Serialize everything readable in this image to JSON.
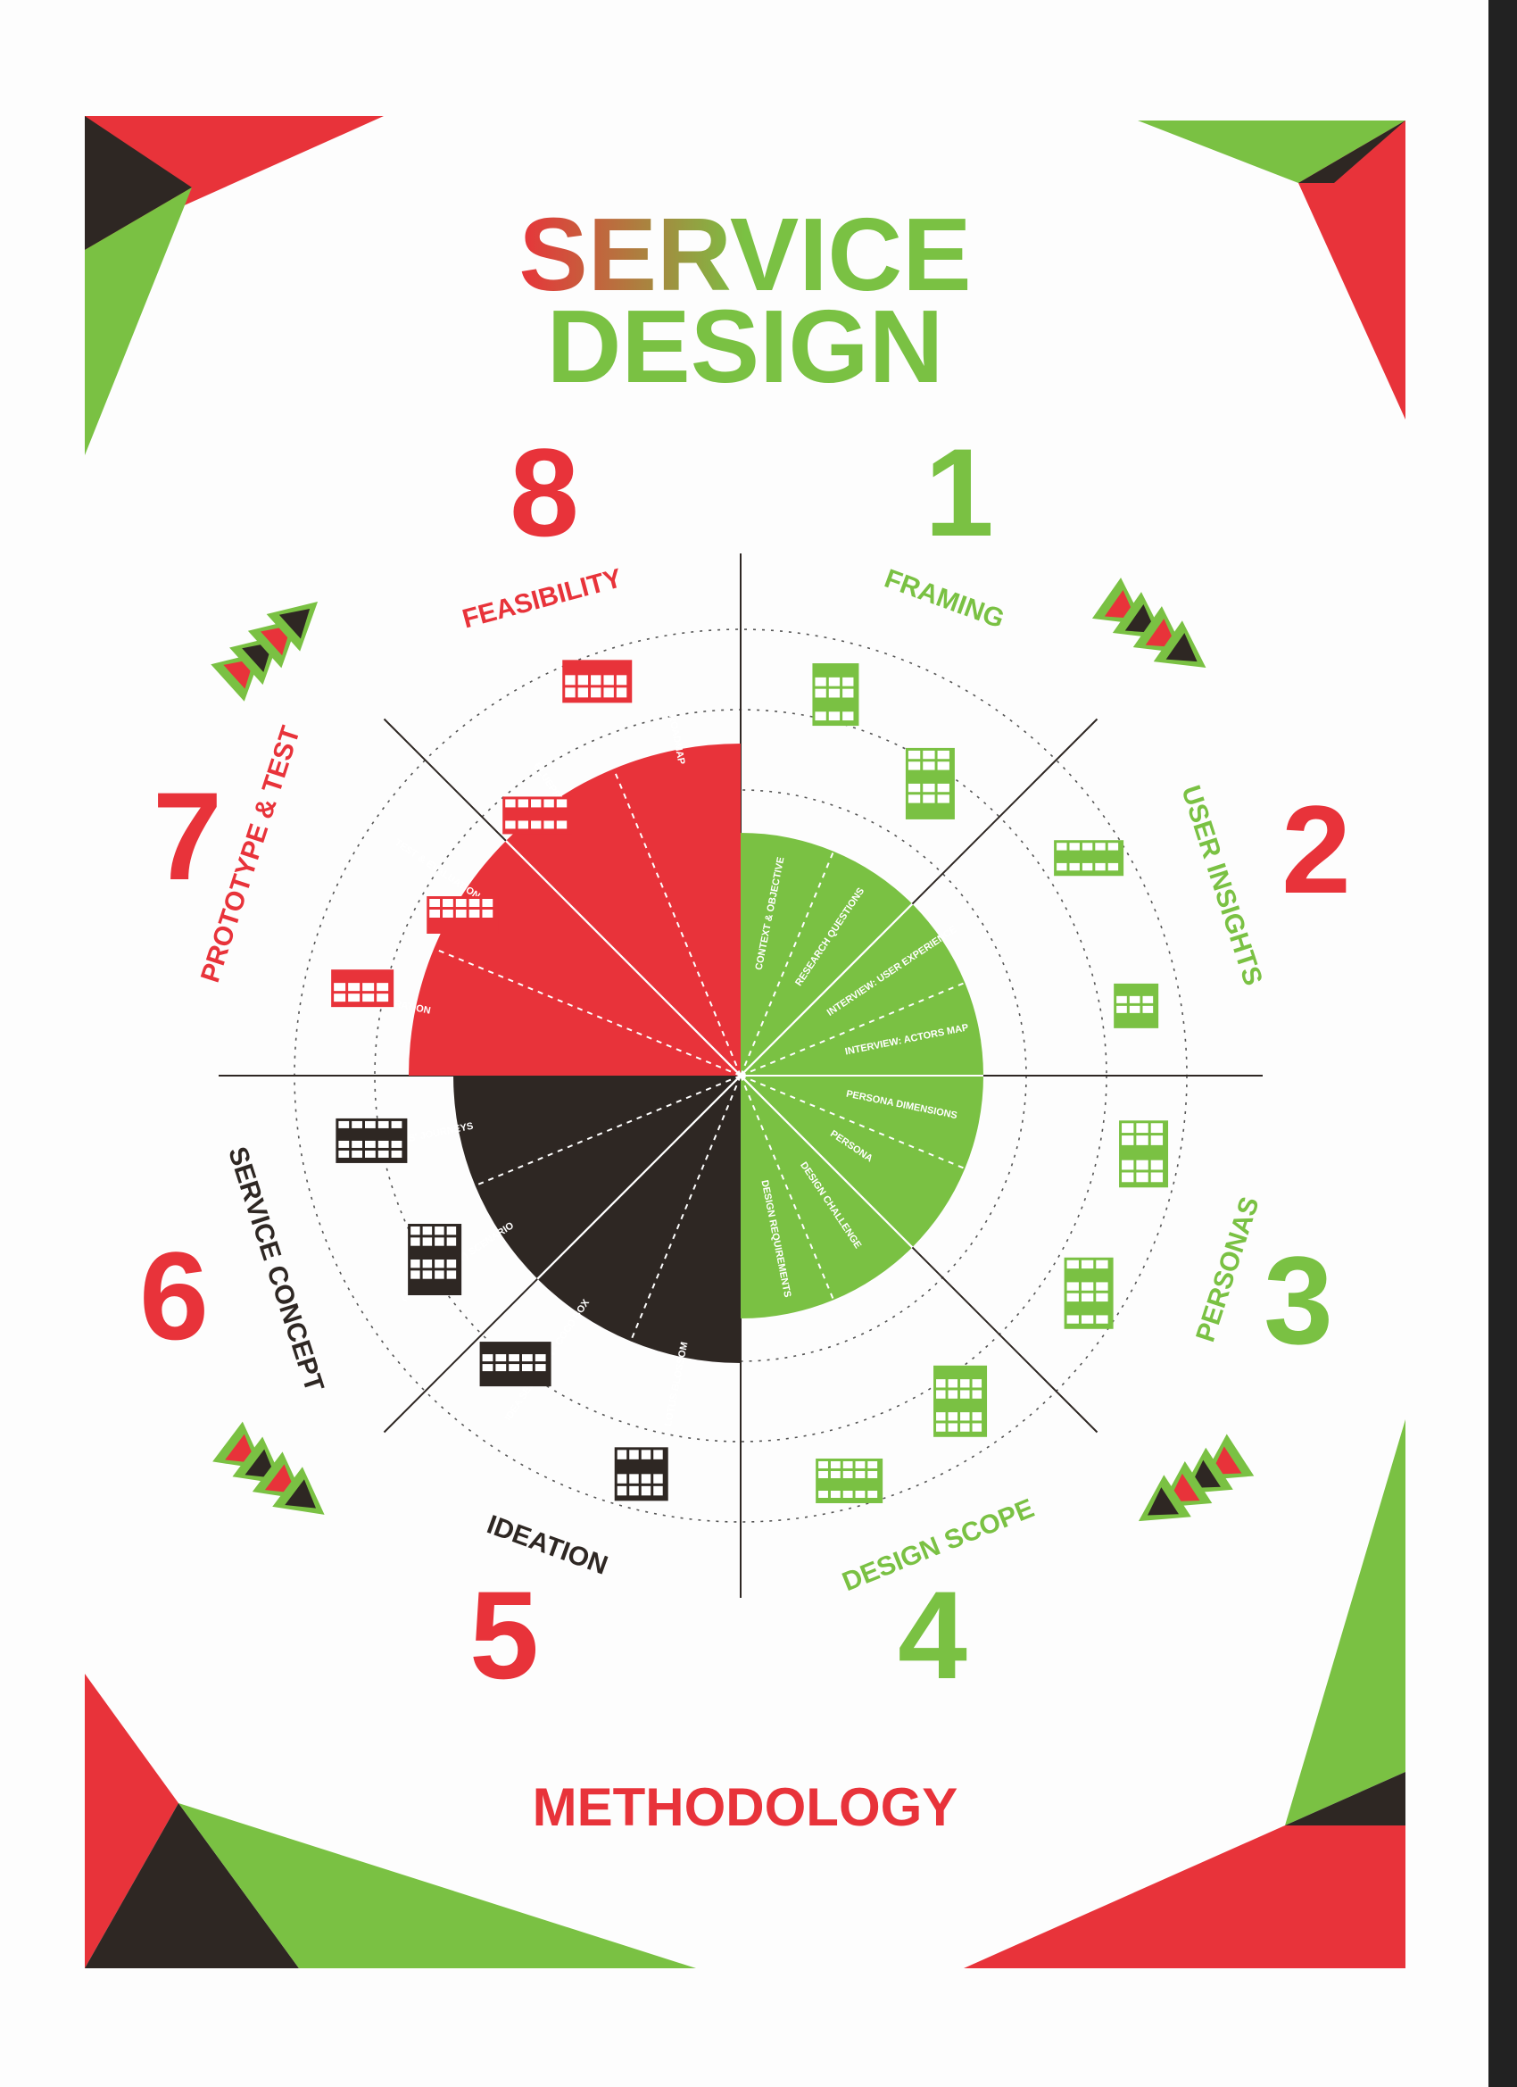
{
  "title": {
    "line1": "SERVICE",
    "line2": "DESIGN"
  },
  "footer": "METHODOLOGY",
  "colors": {
    "red": "#e8333a",
    "green": "#7ac143",
    "black": "#2e2723",
    "paper": "#fdfdfd"
  },
  "phases": [
    {
      "number": "1",
      "label": "FRAMING"
    },
    {
      "number": "2",
      "label": "USER INSIGHTS"
    },
    {
      "number": "3",
      "label": "PERSONAS"
    },
    {
      "number": "4",
      "label": "DESIGN SCOPE"
    },
    {
      "number": "5",
      "label": "IDEATION"
    },
    {
      "number": "6",
      "label": "SERVICE CONCEPT"
    },
    {
      "number": "7",
      "label": "PROTOTYPE & TEST"
    },
    {
      "number": "8",
      "label": "FEASIBILITY"
    }
  ],
  "wheel": {
    "green": [
      "CONTEXT & OBJECTIVE",
      "RESEARCH QUESTIONS",
      "INTERVIEW: USER EXPERIENCE",
      "INTERVIEW: ACTORS MAP",
      "PERSONA DIMENSIONS",
      "PERSONA",
      "DESIGN CHALLENGE",
      "DESIGN REQUIREMENTS"
    ],
    "black": [
      "LOTUS BLOSSOM",
      "IDEA SELECTION - COCD BOX",
      "(SERIOUS PLAY) SCENARIO",
      "USERS' JOURNEYS"
    ],
    "red": [
      "TEST PREPARATION",
      "TEST & EVALUATION",
      "BLUEPRINT",
      "ROADMAP"
    ]
  },
  "icons": [
    "framing-stack-icon",
    "framing-grid-icon",
    "insights-map-icon",
    "insights-target-icon",
    "persona-card-icon",
    "persona-sheet-icon",
    "scope-tree-icon",
    "scope-cards-icon",
    "ideation-matrix-icon",
    "ideation-box-icon",
    "concept-cards-icon",
    "concept-journey-icon",
    "test-grid-icon",
    "test-case-icon",
    "feasibility-blueprint-icon",
    "feasibility-roadmap-icon"
  ]
}
